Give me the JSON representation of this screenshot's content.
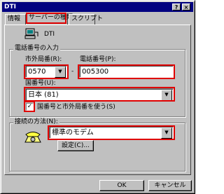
{
  "window": {
    "title": "DTI",
    "help_glyph": "?",
    "close_glyph": "×"
  },
  "tabs": [
    {
      "label": "情報"
    },
    {
      "label": "サーバーの種類"
    },
    {
      "label": "スクリプト"
    }
  ],
  "info": {
    "name": "DTI"
  },
  "phone_group": {
    "title": "電話番号の入力",
    "area_code_label": "市外局番(R):",
    "area_code_value": "0570",
    "separator": "-",
    "phone_label": "電話番号(P):",
    "phone_value": "005300",
    "country_label": "国番号(U):",
    "country_value": "日本 (81)",
    "use_code_label": "国番号と市外局番を使う(S)",
    "use_code_checked": true
  },
  "connect_group": {
    "title": "接続の方法(N):",
    "modem_value": "標準のモデム",
    "settings_label": "設定(C)..."
  },
  "buttons": {
    "ok": "OK",
    "cancel": "キャンセル"
  },
  "colors": {
    "titlebar": "#000080",
    "face": "#c0c0c0",
    "highlight": "#e00000"
  }
}
